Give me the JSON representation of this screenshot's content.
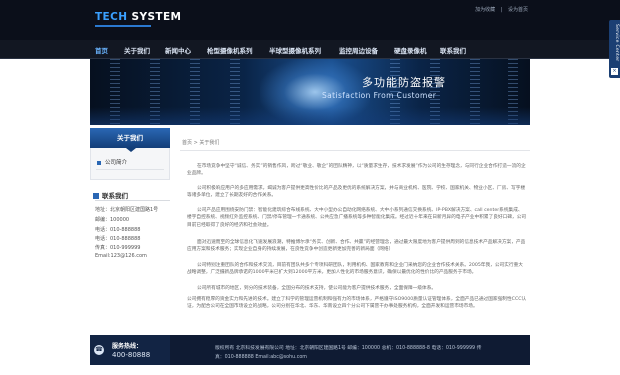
{
  "header": {
    "logo_part1": "TECH",
    "logo_part2": " SYSTEM",
    "links": [
      "加为收藏",
      "|",
      "设为首页"
    ]
  },
  "nav": {
    "items": [
      "首页",
      "关于我们",
      "新闻中心",
      "枪型摄像机系列",
      "半球型摄像机系列",
      "监控周边设备",
      "硬盘录像机",
      "联系我们"
    ]
  },
  "banner": {
    "title": "多功能防盗报警",
    "subtitle": "Satisfaction From Customer"
  },
  "sidebar": {
    "title": "关于我们",
    "menu": [
      "公司简介"
    ]
  },
  "contact": {
    "title": "联系我们",
    "items": [
      "地址：北京朝阳区建国路1号",
      "邮编：100000",
      "电话：010-888888",
      "电话：010-888888",
      "传真：010-999999",
      "Email:123@126.com"
    ]
  },
  "breadcrumb": "首页 > 关于我们",
  "content": {
    "paragraphs": [
      "在市场竞争中坚守“诚信、务实”的销售作风，跨过“敬业、敬企”的团队精神，以“质量求生存，技术求发展”作为公司的生存理念，与同行企业合作打造一流的企业品牌。",
      "公司积极响应用户的多应用需求，竭诚为客户提供更高性价比的产品及更优的系统解决方案，并与商业机构、医院、学校、国家机关、物业小区、厂房、写字楼等诸多单位，建立了长期友好的合作关系。",
      "公司产品应用围绕安防门禁：智能化建筑综合布线系统、大中小型办公自动化网络系统、大中小系列通信交换系统、IP-PBX解决方案、call center系统集成、楼宇自控系统、视频红外监控系统、门禁/停车管理一卡通系统、公共应急广播系统等多种智能化集成。经过近十年来在日新月异的电子产业中积累了良好口碑，公司目前已经取得了良好的经济和社会效益。",
      "面对迅速而至的全球信息化飞速发展浪潮，特推博尔承“务实、创新、合作、共赢”的经营理念，通过最大限度地为客户提供周到的信息技术产品解决方案，产品应用方案和技术服务；实现企业自身的持续发展，在良性竞争中创造更新更加完善的新局面（网络）",
      "公司特别注重团队的合作和技术交流，目前有团队共多个专项科研团队，利用机构、国家教育和企业门采纳您的企业合作技术关系。2005年我，公司实行重大战略调整，广泛摄新品牌承诺的1000平米已扩大到12000平方米，更加人性化的市场服务意识，确保以最优化的性价比的产品服务于市场。",
      "公司所有城市的地区，到分的技术装备，全国分布的技术支持，使公司能为客户提供技术服务，全面保障一级体系。",
      "公司拥有稳厚的资金实力和先进的技术。建立了科学的管理运营机制和强有力的市场体系，严格遵守ISO9000质量认证管理体系，全面产品已通过国家强制性CCC认证，为配合公司在全国市场设立的战略，公司分别在华北、华东、华南设立四个分公司下属营干办事处服务机构，全面开发和运营市场市场。"
    ]
  },
  "footer": {
    "hotline_label": "服务热线：",
    "hotline_number": "400-80888",
    "line1": "版权所有 北京科技发展有限公司 地址：北京朝阳区建国路1号 邮编：100000 总机：010-888888-8 电话：010-999999 传",
    "line2": "真：010-888888 Email:abc@sohu.com"
  },
  "service_tab": {
    "label": "Service Center",
    "close": "×"
  }
}
